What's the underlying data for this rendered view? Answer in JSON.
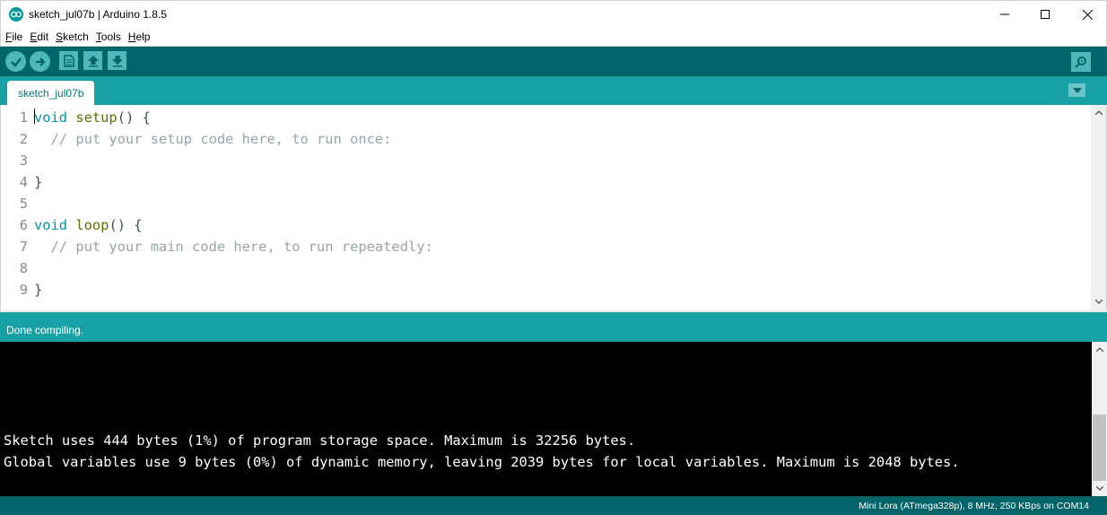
{
  "window": {
    "title": "sketch_jul07b | Arduino 1.8.5",
    "controls": [
      "minimize",
      "maximize",
      "close"
    ]
  },
  "menu": {
    "items": [
      {
        "label": "File",
        "accel": "F",
        "rest": "ile"
      },
      {
        "label": "Edit",
        "accel": "E",
        "rest": "dit"
      },
      {
        "label": "Sketch",
        "accel": "S",
        "rest": "ketch"
      },
      {
        "label": "Tools",
        "accel": "T",
        "rest": "ools"
      },
      {
        "label": "Help",
        "accel": "H",
        "rest": "elp"
      }
    ]
  },
  "toolbar": {
    "buttons": [
      "verify-icon",
      "upload-icon",
      "new-icon",
      "open-icon",
      "save-icon"
    ],
    "serial_monitor": "serial-monitor-icon"
  },
  "tabs": {
    "active": "sketch_jul07b"
  },
  "editor": {
    "lines": [
      {
        "num": "1",
        "parts": [
          {
            "t": "void",
            "c": "kw-type"
          },
          {
            "t": " ",
            "c": "plain"
          },
          {
            "t": "setup",
            "c": "kw-fn"
          },
          {
            "t": "() {",
            "c": "plain"
          }
        ]
      },
      {
        "num": "2",
        "parts": [
          {
            "t": "  // put your setup code here, to run once:",
            "c": "comment"
          }
        ]
      },
      {
        "num": "3",
        "parts": []
      },
      {
        "num": "4",
        "parts": [
          {
            "t": "}",
            "c": "plain"
          }
        ]
      },
      {
        "num": "5",
        "parts": []
      },
      {
        "num": "6",
        "parts": [
          {
            "t": "void",
            "c": "kw-type"
          },
          {
            "t": " ",
            "c": "plain"
          },
          {
            "t": "loop",
            "c": "kw-fn"
          },
          {
            "t": "() {",
            "c": "plain"
          }
        ]
      },
      {
        "num": "7",
        "parts": [
          {
            "t": "  // put your main code here, to run repeatedly:",
            "c": "comment"
          }
        ]
      },
      {
        "num": "8",
        "parts": []
      },
      {
        "num": "9",
        "parts": [
          {
            "t": "}",
            "c": "plain"
          }
        ]
      }
    ]
  },
  "status": {
    "message": "Done compiling."
  },
  "console": {
    "lines": [
      "Sketch uses 444 bytes (1%) of program storage space. Maximum is 32256 bytes.",
      "Global variables use 9 bytes (0%) of dynamic memory, leaving 2039 bytes for local variables. Maximum is 2048 bytes."
    ]
  },
  "board": {
    "info": "Mini Lora (ATmega328p), 8 MHz, 250 KBps on COM14"
  },
  "colors": {
    "teal_dark": "#006468",
    "teal": "#17a1a5",
    "button": "#4db7bb",
    "keyword": "#00979c",
    "function": "#5e6d03",
    "comment": "#95a5a6"
  }
}
